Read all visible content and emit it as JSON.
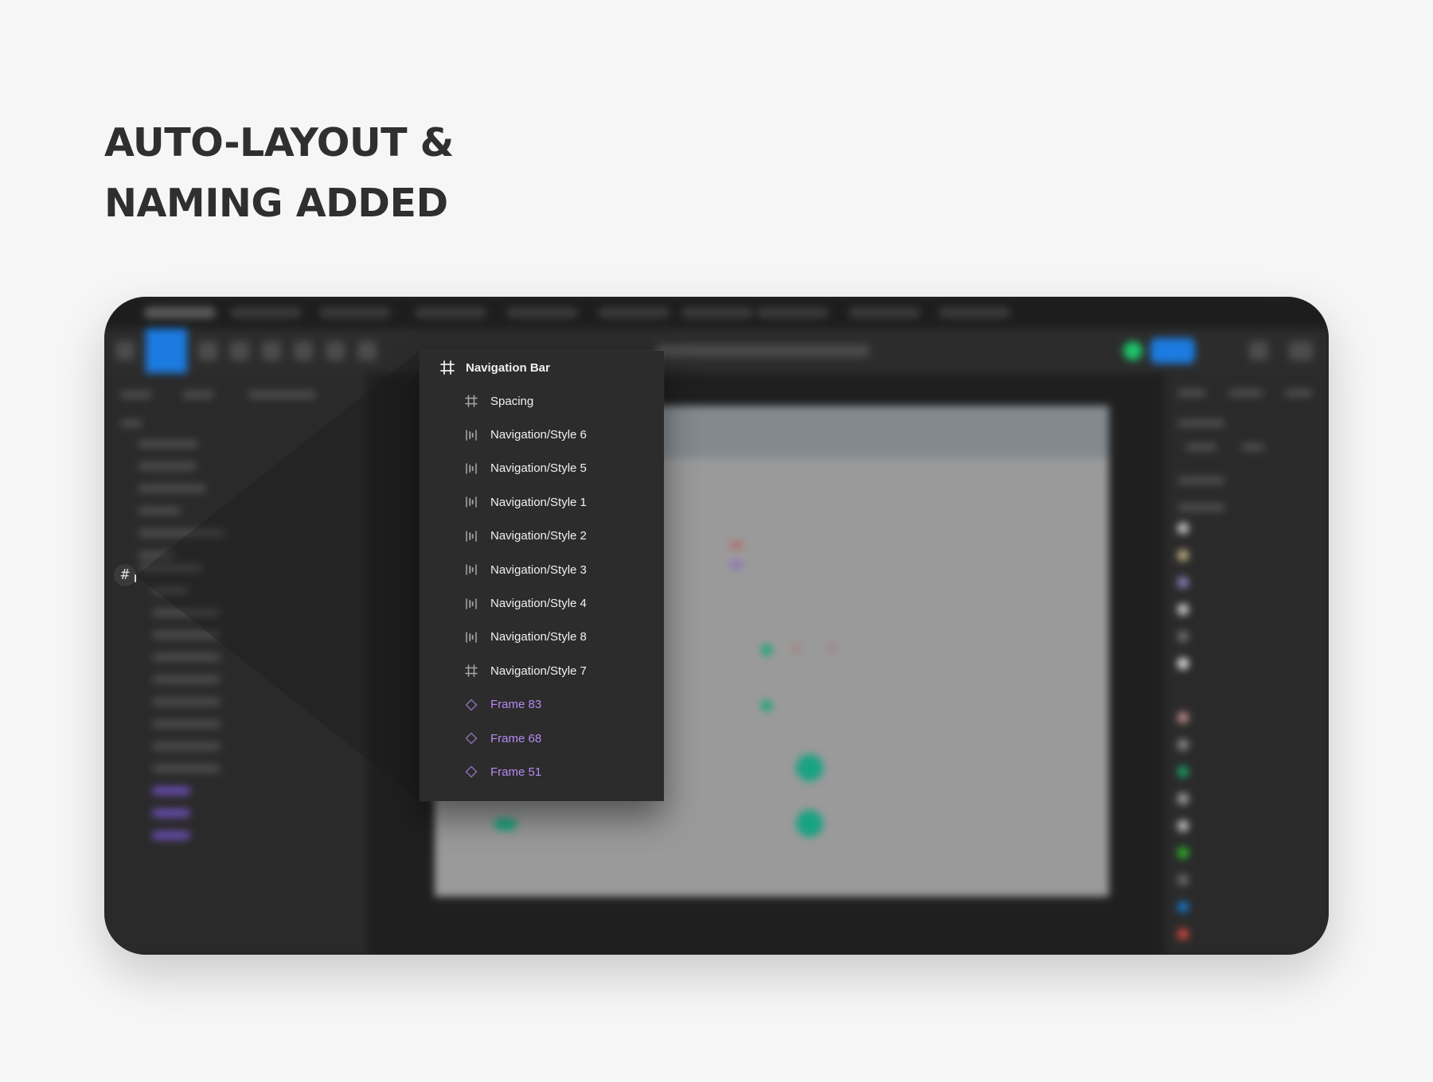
{
  "headline": {
    "line1": "AUTO-LAYOUT &",
    "line2": "NAMING ADDED"
  },
  "layers_panel": {
    "root": {
      "label": "Navigation Bar",
      "icon": "frame-icon"
    },
    "items": [
      {
        "label": "Spacing",
        "icon": "frame-icon"
      },
      {
        "label": "Navigation/Style 6",
        "icon": "auto-layout-icon"
      },
      {
        "label": "Navigation/Style 5",
        "icon": "auto-layout-icon"
      },
      {
        "label": "Navigation/Style 1",
        "icon": "auto-layout-icon"
      },
      {
        "label": "Navigation/Style 2",
        "icon": "auto-layout-icon"
      },
      {
        "label": "Navigation/Style 3",
        "icon": "auto-layout-icon"
      },
      {
        "label": "Navigation/Style 4",
        "icon": "auto-layout-icon"
      },
      {
        "label": "Navigation/Style 8",
        "icon": "auto-layout-icon"
      },
      {
        "label": "Navigation/Style 7",
        "icon": "frame-icon"
      },
      {
        "label": "Frame 83",
        "icon": "component-instance-icon"
      },
      {
        "label": "Frame 68",
        "icon": "component-instance-icon"
      },
      {
        "label": "Frame 51",
        "icon": "component-instance-icon"
      }
    ]
  },
  "colors": {
    "page_background": "#f6f6f6",
    "headline_text": "#2f2f2f",
    "app_background": "#242424",
    "popup_background": "#2c2c2c",
    "popup_text": "#f0f0f0",
    "component_label": "#b789f4",
    "accent_blue": "#1b7be0",
    "accent_green": "#1cc46a"
  }
}
